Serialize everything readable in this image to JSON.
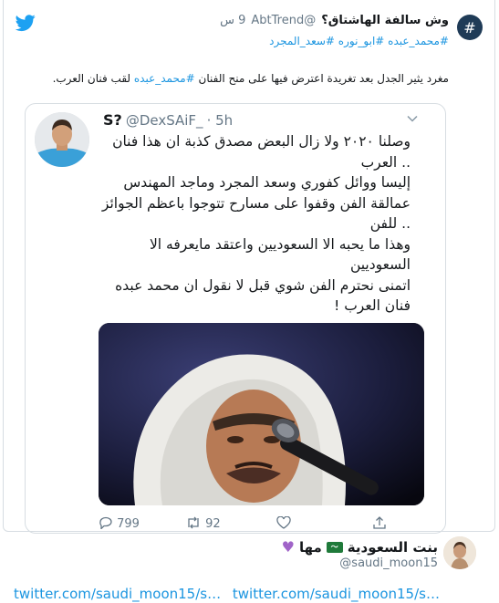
{
  "trend": {
    "name": "وش سالفة الهاشتاق؟",
    "handle": "@AbtTrend",
    "time": "9 س",
    "hashtags": "#محمد_عبده #ابو_نوره #سعد_المجرد",
    "text_before": "مغرد يثير الجدل بعد تغريدة اعترض فيها على منح الفنان",
    "text_tag": "#محمد_عبده",
    "text_after": "لقب فنان العرب."
  },
  "embed": {
    "name": "S?",
    "handle": "@DexSAiF_",
    "time": "· 5h",
    "lines": [
      "وصلنا ٢٠٢٠ ولا زال البعض مصدق كذبة ان هذا فنان",
      ".. العرب",
      "إليسا ووائل كفوري وسعد المجرد وماجد المهندس",
      "عمالقة الفن وقفوا على مسارح تتوجوا باعظم الجوائز",
      ".. للفن",
      "وهذا ما يحبه الا السعوديين واعتقد مايعرفه الا",
      "السعوديين",
      "اتمنى نحترم الفن شوي قبل لا نقول ان محمد عبده",
      "فنان العرب !"
    ],
    "actions": {
      "reply": "799",
      "retweet": "92",
      "like": ""
    }
  },
  "user2": {
    "name": "بنت السعودية",
    "flag_text": "مها",
    "handle": "@saudi_moon15"
  },
  "links": [
    "twitter.com/saudi_moon15/s…",
    "twitter.com/saudi_moon15/s…"
  ],
  "colors": {
    "link": "#1b95e0",
    "muted": "#657786",
    "text": "#14171a",
    "border": "#d7dde2"
  },
  "icons": [
    "twitter-bird-icon",
    "chevron-down-icon",
    "reply-icon",
    "retweet-icon",
    "like-icon",
    "heart-icon",
    "saudi-flag-icon"
  ]
}
